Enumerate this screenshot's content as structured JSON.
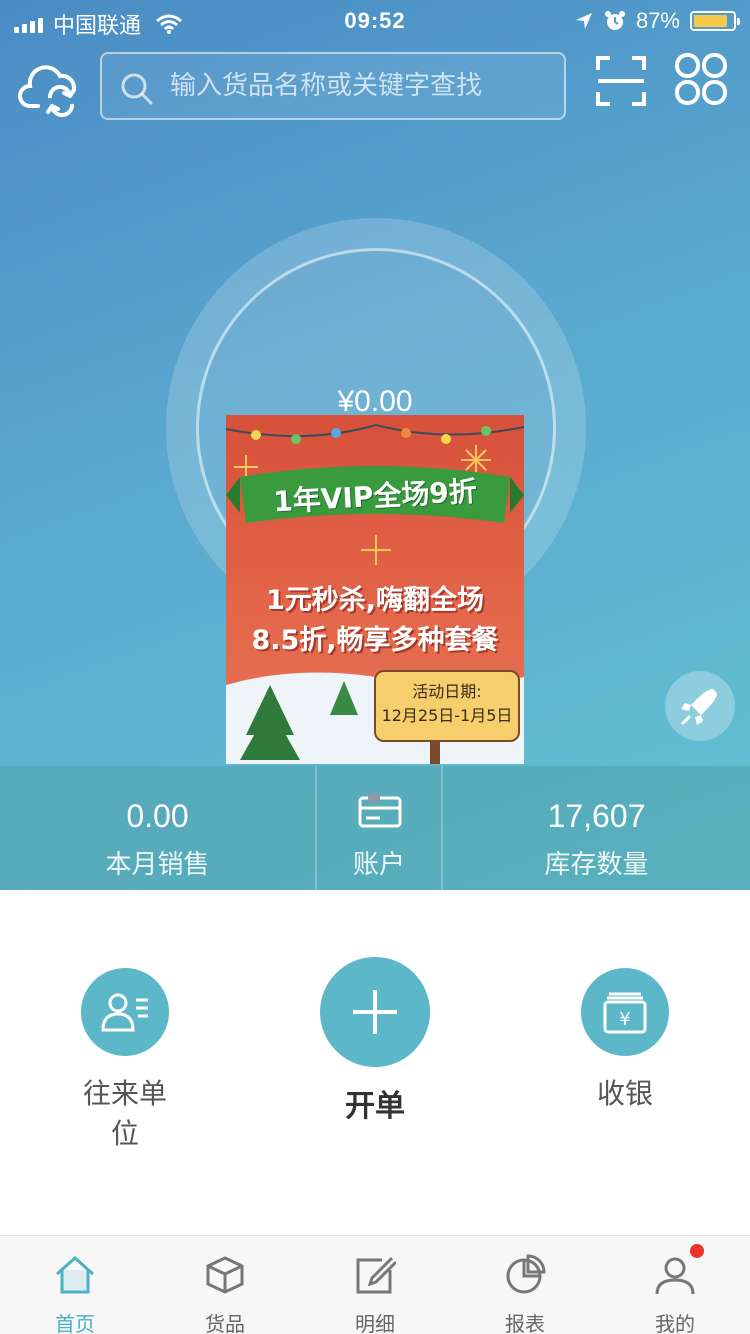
{
  "status_bar": {
    "carrier": "中国联通",
    "time": "09:52",
    "battery_percent": "87%"
  },
  "search": {
    "placeholder": "输入货品名称或关键字查找"
  },
  "summary": {
    "amount": "¥0.00"
  },
  "promo": {
    "headline": "1年VIP全场9折",
    "line1": "1元秒杀,嗨翻全场",
    "line2": "8.5折,畅享多种套餐",
    "date_label": "活动日期:",
    "date_range": "12月25日-1月5日"
  },
  "stats": [
    {
      "value": "0.00",
      "label": "本月销售"
    },
    {
      "value": "",
      "label": "账户"
    },
    {
      "value": "17,607",
      "label": "库存数量"
    }
  ],
  "actions": [
    {
      "label": "往来单位"
    },
    {
      "label": "开单"
    },
    {
      "label": "收银"
    }
  ],
  "tabs": [
    {
      "label": "首页",
      "active": true
    },
    {
      "label": "货品"
    },
    {
      "label": "明细"
    },
    {
      "label": "报表"
    },
    {
      "label": "我的",
      "badge": true
    }
  ],
  "colors": {
    "accent": "#5cb8c8",
    "active_tab": "#4ab0c6",
    "badge": "#e8342c",
    "hero_top": "#4a8cc5",
    "hero_bottom": "#63c3d2"
  }
}
